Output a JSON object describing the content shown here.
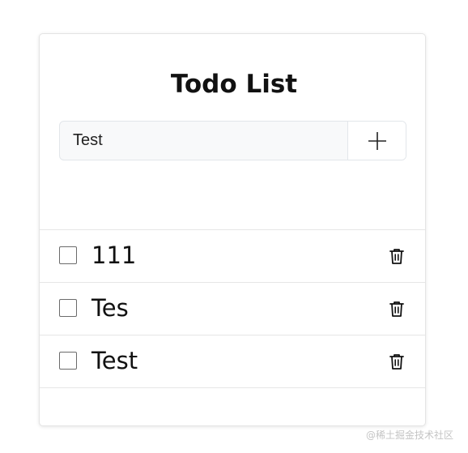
{
  "header": {
    "title": "Todo List"
  },
  "new_todo": {
    "value": "Test",
    "add_icon": "plus-icon"
  },
  "todos": [
    {
      "text": "111",
      "checked": false,
      "delete_icon": "trash-icon"
    },
    {
      "text": "Tes",
      "checked": false,
      "delete_icon": "trash-icon"
    },
    {
      "text": "Test",
      "checked": false,
      "delete_icon": "trash-icon"
    }
  ],
  "watermark": "@稀土掘金技术社区"
}
